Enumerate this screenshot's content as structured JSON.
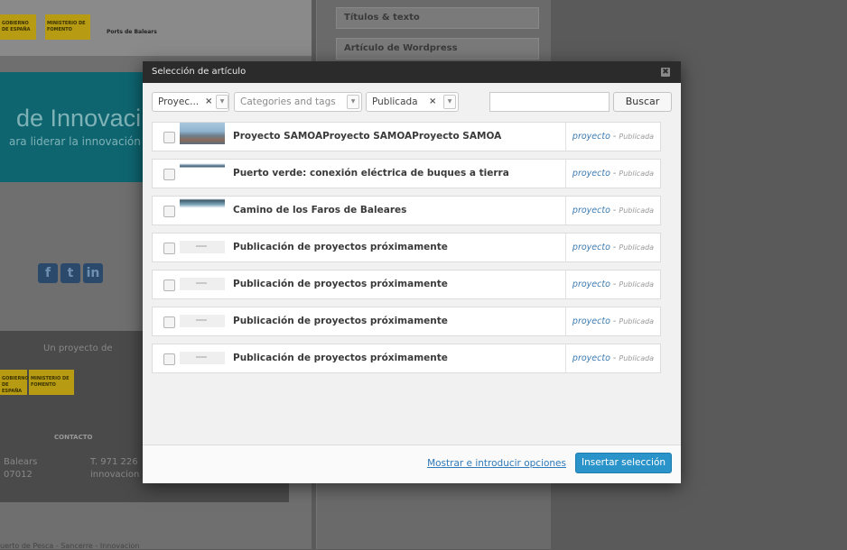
{
  "background": {
    "logo_left_1": "GOBIERNO DE ESPAÑA",
    "logo_left_2": "MINISTERIO DE FOMENTO",
    "logo_brand": "Ports de Balears",
    "banner_title": "de Innovaci",
    "banner_sub": "ara liderar la innovación",
    "social": [
      "f",
      "t",
      "in"
    ],
    "footer_project": "Un proyecto de",
    "footer_contact": "CONTACTO",
    "footer_addr_1": "Balears",
    "footer_addr_2": "07012",
    "footer_phone": "T. 971 226",
    "footer_email": "innovacion",
    "panel_chip_1": "Títulos & texto",
    "panel_chip_2": "Artículo de Wordpress",
    "bottom_text": "uerto de Pesca - Sancerre - Innovacion"
  },
  "modal": {
    "title": "Selección de artículo",
    "close_glyph": "✖",
    "filters": {
      "type_value": "Proyec...",
      "clear_glyph": "×",
      "arrow_glyph": "▼",
      "categories_placeholder": "Categories and tags",
      "status_value": "Publicada",
      "search_button": "Buscar"
    },
    "rows": [
      {
        "title": "Proyecto SAMOAProyecto SAMOAProyecto SAMOA",
        "type": "proyecto",
        "status": "Publicada",
        "thumb": "photo1"
      },
      {
        "title": "Puerto verde: conexión eléctrica de buques a tierra",
        "type": "proyecto",
        "status": "Publicada",
        "thumb": "photo2"
      },
      {
        "title": "Camino de los Faros de Baleares",
        "type": "proyecto",
        "status": "Publicada",
        "thumb": "photo3"
      },
      {
        "title": "Publicación de proyectos próximamente",
        "type": "proyecto",
        "status": "Publicada",
        "thumb": "placeholder-img"
      },
      {
        "title": "Publicación de proyectos próximamente",
        "type": "proyecto",
        "status": "Publicada",
        "thumb": "placeholder-img"
      },
      {
        "title": "Publicación de proyectos próximamente",
        "type": "proyecto",
        "status": "Publicada",
        "thumb": "placeholder-img"
      },
      {
        "title": "Publicación de proyectos próximamente",
        "type": "proyecto",
        "status": "Publicada",
        "thumb": "placeholder-img"
      }
    ],
    "meta_separator": " - ",
    "footer": {
      "options_link": "Mostrar e introducir opciones",
      "insert_button": "Insertar selección"
    }
  }
}
